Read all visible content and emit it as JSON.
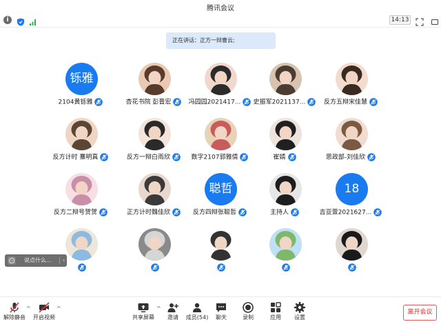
{
  "window": {
    "title": "腾讯会议"
  },
  "status": {
    "time": "14:13"
  },
  "banner": {
    "speaking": "正在讲话：正方一辩曹云;"
  },
  "participants": [
    {
      "name": "2104黄铄雅",
      "avatar_text": "铄雅"
    },
    {
      "name": "杏花书院 彭晋宏"
    },
    {
      "name": "冯园园2021417..."
    },
    {
      "name": "史振军2021137..."
    },
    {
      "name": "反方五辩宋佳慧"
    },
    {
      "name": "反方计时 蹇明真"
    },
    {
      "name": "反方一辩白雨欣"
    },
    {
      "name": "数字2107郭雅倩"
    },
    {
      "name": "崔婧"
    },
    {
      "name": "思政部-刘佳欣"
    },
    {
      "name": "反方二辩号贺贺"
    },
    {
      "name": "正方计时魏佳欣"
    },
    {
      "name": "反方四辩张聪哲",
      "avatar_text": "聪哲"
    },
    {
      "name": "主持人"
    },
    {
      "name": "吉亚萱2021627...",
      "avatar_text": "18"
    },
    {
      "name": ""
    },
    {
      "name": ""
    },
    {
      "name": ""
    },
    {
      "name": ""
    },
    {
      "name": ""
    }
  ],
  "comment": {
    "placeholder": "说点什么...",
    "arrow": "‹"
  },
  "toolbar": {
    "mute": "解除静音",
    "video": "开启视频",
    "share": "共享屏幕",
    "invite": "邀请",
    "members": "成员(54)",
    "chat": "聊天",
    "record": "录制",
    "apps": "应用",
    "settings": "设置",
    "leave": "离开会议",
    "caret": "^"
  },
  "colors": {
    "accent": "#1a7bf0",
    "banner": "#dbe9fb",
    "leave": "#d33333"
  }
}
